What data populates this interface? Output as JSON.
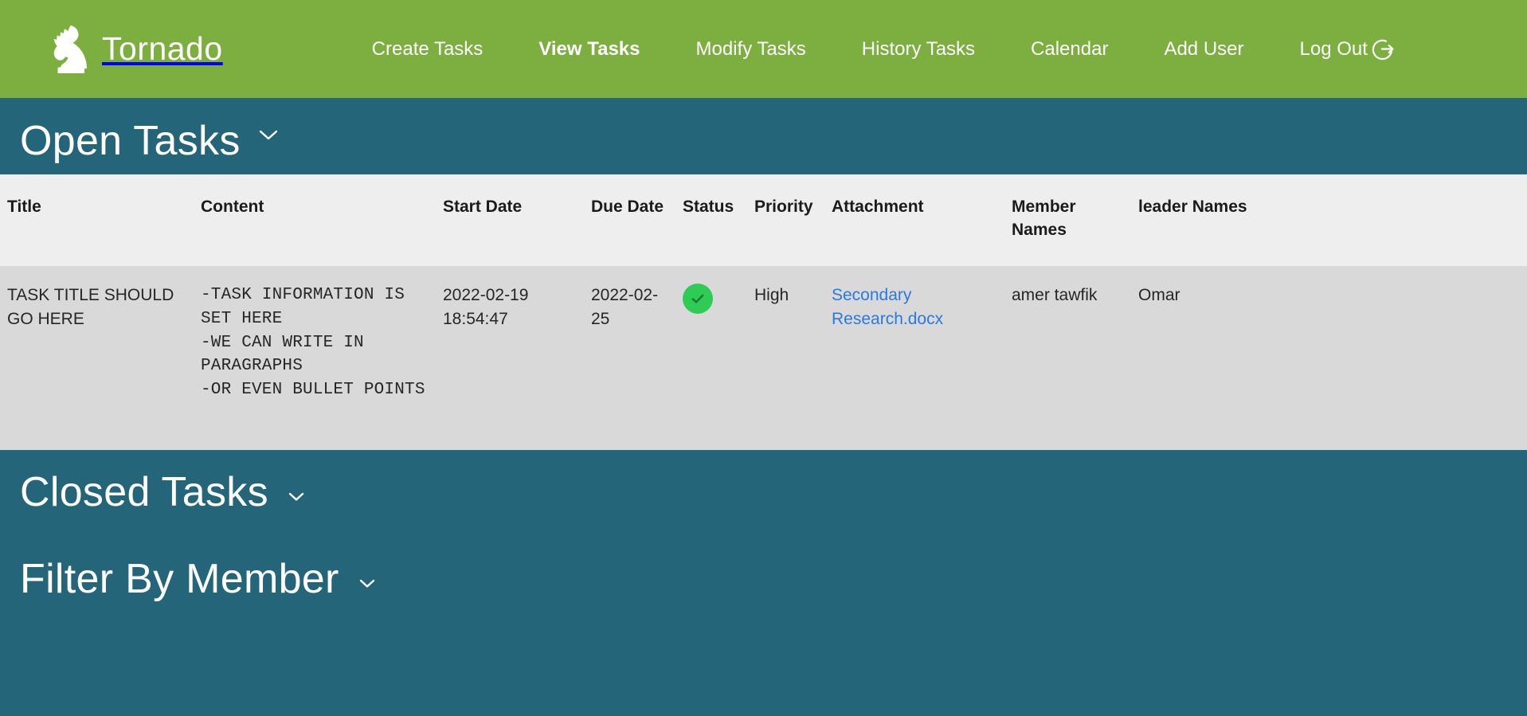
{
  "brand": {
    "name": "Tornado",
    "logo_icon": "chess-knight-icon"
  },
  "nav": {
    "items": [
      {
        "label": "Create Tasks",
        "active": false
      },
      {
        "label": "View Tasks",
        "active": true
      },
      {
        "label": "Modify Tasks",
        "active": false
      },
      {
        "label": "History Tasks",
        "active": false
      },
      {
        "label": "Calendar",
        "active": false
      },
      {
        "label": "Add User",
        "active": false
      },
      {
        "label": "Log Out",
        "active": false,
        "icon": "sign-out-icon"
      }
    ]
  },
  "sections": {
    "open_tasks": {
      "title": "Open Tasks",
      "toggle_icon": "chevron-down-icon",
      "expanded": true
    },
    "closed_tasks": {
      "title": "Closed Tasks",
      "toggle_icon": "chevron-down-icon",
      "expanded": false
    },
    "filter_by_member": {
      "title": "Filter By Member",
      "toggle_icon": "chevron-down-icon",
      "expanded": false
    }
  },
  "table": {
    "columns": [
      "Title",
      "Content",
      "Start Date",
      "Due Date",
      "Status",
      "Priority",
      "Attachment",
      "Member Names",
      "leader Names"
    ],
    "rows": [
      {
        "title": "TASK TITLE SHOULD GO HERE",
        "content": "-TASK INFORMATION IS SET HERE\n-WE CAN WRITE IN PARAGRAPHS\n-OR EVEN BULLET POINTS",
        "start_date": "2022-02-19 18:54:47",
        "due_date": "2022-02-25",
        "status": "complete",
        "status_icon": "check-circle-icon",
        "priority": "High",
        "attachment": "Secondary Research.docx",
        "member_names": "amer tawfik",
        "leader_names": "Omar"
      }
    ]
  },
  "colors": {
    "brand_green": "#7cae40",
    "panel_teal": "#25657a",
    "table_header_bg": "#eeeeee",
    "table_row_bg": "#d9d9d9",
    "link_blue": "#2a7ade",
    "status_green": "#2ecc55"
  }
}
